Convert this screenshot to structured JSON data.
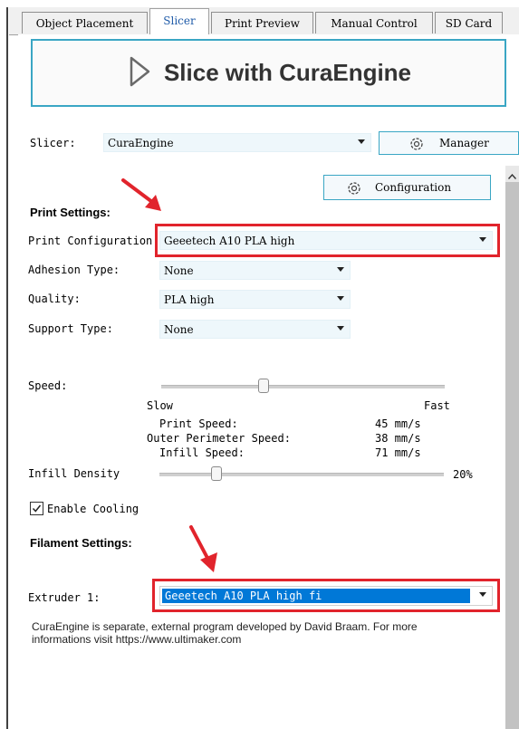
{
  "tabs": [
    "Object Placement",
    "Slicer",
    "Print Preview",
    "Manual Control",
    "SD Card"
  ],
  "active_tab": "Slicer",
  "slice_button": {
    "label": "Slice with CuraEngine"
  },
  "slicer": {
    "label": "Slicer:",
    "value": "CuraEngine",
    "manager_label": "Manager"
  },
  "configuration_label": "Configuration",
  "print_settings": {
    "heading": "Print Settings:",
    "print_configuration": {
      "label": "Print Configuration:",
      "value": "Geeetech A10 PLA high"
    },
    "adhesion": {
      "label": "Adhesion Type:",
      "value": "None"
    },
    "quality": {
      "label": "Quality:",
      "value": "PLA high"
    },
    "support": {
      "label": "Support Type:",
      "value": "None"
    },
    "speed": {
      "label": "Speed:",
      "slow": "Slow",
      "fast": "Fast",
      "level": 0.36,
      "rows": [
        {
          "name": "Print Speed:",
          "value": "45 mm/s"
        },
        {
          "name": "Outer Perimeter Speed:",
          "value": "38 mm/s"
        },
        {
          "name": "Infill Speed:",
          "value": "71 mm/s"
        }
      ]
    },
    "infill": {
      "label": "Infill Density",
      "value": "20%",
      "level": 0.2
    },
    "cooling": {
      "label": "Enable Cooling",
      "checked": true
    }
  },
  "filament_settings": {
    "heading": "Filament Settings:",
    "extruder": {
      "label": "Extruder 1:",
      "value": "Geeetech A10 PLA high fi"
    }
  },
  "info_text": "CuraEngine is separate, external program developed by David Braam. For more informations visit https://www.ultimaker.com",
  "colors": {
    "accent": "#3aa6c4",
    "highlight_red": "#e1242c",
    "selection_blue": "#0078d7"
  }
}
